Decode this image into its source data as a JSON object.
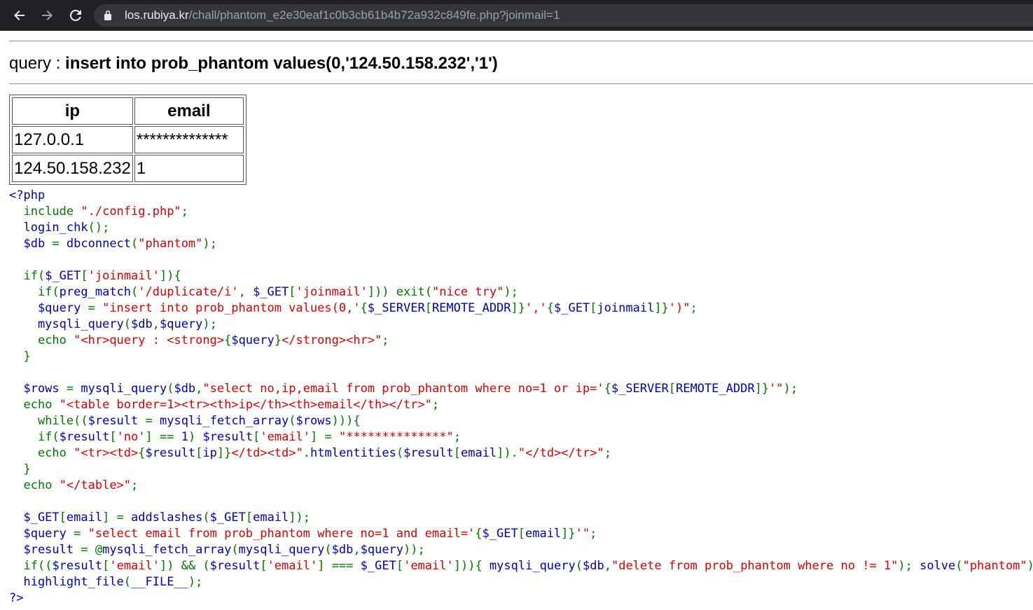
{
  "browser": {
    "back_icon": "arrow-left-icon",
    "forward_icon": "arrow-right-icon",
    "reload_icon": "reload-icon",
    "lock_icon": "lock-icon",
    "url_host": "los.rubiya.kr",
    "url_path": "/chall/phantom_e2e30eaf1c0b3cb61b4b72a932c849fe.php?joinmail=1"
  },
  "page": {
    "query_label": "query : ",
    "query_text": "insert into prob_phantom values(0,'124.50.158.232','1')",
    "table": {
      "headers": [
        "ip",
        "email"
      ],
      "rows": [
        [
          "127.0.0.1",
          "**************"
        ],
        [
          "124.50.158.232",
          "1"
        ]
      ]
    },
    "code_lines": [
      [
        [
          "df",
          "<?php"
        ]
      ],
      [
        [
          "df",
          "  "
        ],
        [
          "kw",
          "include "
        ],
        [
          "st",
          "\"./config.php\""
        ],
        [
          "kw",
          ";"
        ]
      ],
      [
        [
          "df",
          "  login_chk"
        ],
        [
          "kw",
          "();"
        ]
      ],
      [
        [
          "df",
          "  $db "
        ],
        [
          "kw",
          "= "
        ],
        [
          "df",
          "dbconnect"
        ],
        [
          "kw",
          "("
        ],
        [
          "st",
          "\"phantom\""
        ],
        [
          "kw",
          ");"
        ]
      ],
      [
        [
          "df",
          " "
        ]
      ],
      [
        [
          "df",
          "  "
        ],
        [
          "kw",
          "if("
        ],
        [
          "df",
          "$_GET"
        ],
        [
          "kw",
          "["
        ],
        [
          "st",
          "'joinmail'"
        ],
        [
          "kw",
          "]){"
        ]
      ],
      [
        [
          "df",
          "    "
        ],
        [
          "kw",
          "if("
        ],
        [
          "df",
          "preg_match"
        ],
        [
          "kw",
          "("
        ],
        [
          "st",
          "'/duplicate/i'"
        ],
        [
          "kw",
          ", "
        ],
        [
          "df",
          "$_GET"
        ],
        [
          "kw",
          "["
        ],
        [
          "st",
          "'joinmail'"
        ],
        [
          "kw",
          "])) exit("
        ],
        [
          "st",
          "\"nice try\""
        ],
        [
          "kw",
          ");"
        ]
      ],
      [
        [
          "df",
          "    $query "
        ],
        [
          "kw",
          "= "
        ],
        [
          "st",
          "\"insert into prob_phantom values(0,'"
        ],
        [
          "kw",
          "{"
        ],
        [
          "df",
          "$_SERVER"
        ],
        [
          "kw",
          "["
        ],
        [
          "df",
          "REMOTE_ADDR"
        ],
        [
          "kw",
          "]}"
        ],
        [
          "st",
          "','"
        ],
        [
          "kw",
          "{"
        ],
        [
          "df",
          "$_GET"
        ],
        [
          "kw",
          "["
        ],
        [
          "df",
          "joinmail"
        ],
        [
          "kw",
          "]}"
        ],
        [
          "st",
          "')\""
        ],
        [
          "kw",
          ";"
        ]
      ],
      [
        [
          "df",
          "    mysqli_query"
        ],
        [
          "kw",
          "("
        ],
        [
          "df",
          "$db"
        ],
        [
          "kw",
          ","
        ],
        [
          "df",
          "$query"
        ],
        [
          "kw",
          ");"
        ]
      ],
      [
        [
          "df",
          "    "
        ],
        [
          "kw",
          "echo "
        ],
        [
          "st",
          "\"<hr>query : <strong>"
        ],
        [
          "kw",
          "{"
        ],
        [
          "df",
          "$query"
        ],
        [
          "kw",
          "}"
        ],
        [
          "st",
          "</strong><hr>\""
        ],
        [
          "kw",
          ";"
        ]
      ],
      [
        [
          "df",
          "  "
        ],
        [
          "kw",
          "}"
        ]
      ],
      [
        [
          "df",
          " "
        ]
      ],
      [
        [
          "df",
          "  $rows "
        ],
        [
          "kw",
          "= "
        ],
        [
          "df",
          "mysqli_query"
        ],
        [
          "kw",
          "("
        ],
        [
          "df",
          "$db"
        ],
        [
          "kw",
          ","
        ],
        [
          "st",
          "\"select no,ip,email from prob_phantom where no=1 or ip='"
        ],
        [
          "kw",
          "{"
        ],
        [
          "df",
          "$_SERVER"
        ],
        [
          "kw",
          "["
        ],
        [
          "df",
          "REMOTE_ADDR"
        ],
        [
          "kw",
          "]}"
        ],
        [
          "st",
          "'\""
        ],
        [
          "kw",
          ");"
        ]
      ],
      [
        [
          "df",
          "  "
        ],
        [
          "kw",
          "echo "
        ],
        [
          "st",
          "\"<table border=1><tr><th>ip</th><th>email</th></tr>\""
        ],
        [
          "kw",
          ";"
        ]
      ],
      [
        [
          "df",
          "    "
        ],
        [
          "kw",
          "while(("
        ],
        [
          "df",
          "$result "
        ],
        [
          "kw",
          "= "
        ],
        [
          "df",
          "mysqli_fetch_array"
        ],
        [
          "kw",
          "("
        ],
        [
          "df",
          "$rows"
        ],
        [
          "kw",
          "))){"
        ]
      ],
      [
        [
          "df",
          "    "
        ],
        [
          "kw",
          "if("
        ],
        [
          "df",
          "$result"
        ],
        [
          "kw",
          "["
        ],
        [
          "st",
          "'no'"
        ],
        [
          "kw",
          "] == "
        ],
        [
          "df",
          "1"
        ],
        [
          "kw",
          ") "
        ],
        [
          "df",
          "$result"
        ],
        [
          "kw",
          "["
        ],
        [
          "st",
          "'email'"
        ],
        [
          "kw",
          "] = "
        ],
        [
          "st",
          "\"**************\""
        ],
        [
          "kw",
          ";"
        ]
      ],
      [
        [
          "df",
          "    "
        ],
        [
          "kw",
          "echo "
        ],
        [
          "st",
          "\"<tr><td>"
        ],
        [
          "kw",
          "{"
        ],
        [
          "df",
          "$result"
        ],
        [
          "kw",
          "["
        ],
        [
          "df",
          "ip"
        ],
        [
          "kw",
          "]}"
        ],
        [
          "st",
          "</td><td>\""
        ],
        [
          "kw",
          "."
        ],
        [
          "df",
          "htmlentities"
        ],
        [
          "kw",
          "("
        ],
        [
          "df",
          "$result"
        ],
        [
          "kw",
          "["
        ],
        [
          "df",
          "email"
        ],
        [
          "kw",
          "])."
        ],
        [
          "st",
          "\"</td></tr>\""
        ],
        [
          "kw",
          ";"
        ]
      ],
      [
        [
          "df",
          "  "
        ],
        [
          "kw",
          "}"
        ]
      ],
      [
        [
          "df",
          "  "
        ],
        [
          "kw",
          "echo "
        ],
        [
          "st",
          "\"</table>\""
        ],
        [
          "kw",
          ";"
        ]
      ],
      [
        [
          "df",
          " "
        ]
      ],
      [
        [
          "df",
          "  $_GET"
        ],
        [
          "kw",
          "["
        ],
        [
          "df",
          "email"
        ],
        [
          "kw",
          "] = "
        ],
        [
          "df",
          "addslashes"
        ],
        [
          "kw",
          "("
        ],
        [
          "df",
          "$_GET"
        ],
        [
          "kw",
          "["
        ],
        [
          "df",
          "email"
        ],
        [
          "kw",
          "]);"
        ]
      ],
      [
        [
          "df",
          "  $query "
        ],
        [
          "kw",
          "= "
        ],
        [
          "st",
          "\"select email from prob_phantom where no=1 and email='"
        ],
        [
          "kw",
          "{"
        ],
        [
          "df",
          "$_GET"
        ],
        [
          "kw",
          "["
        ],
        [
          "df",
          "email"
        ],
        [
          "kw",
          "]}"
        ],
        [
          "st",
          "'\""
        ],
        [
          "kw",
          ";"
        ]
      ],
      [
        [
          "df",
          "  $result "
        ],
        [
          "kw",
          "= @"
        ],
        [
          "df",
          "mysqli_fetch_array"
        ],
        [
          "kw",
          "("
        ],
        [
          "df",
          "mysqli_query"
        ],
        [
          "kw",
          "("
        ],
        [
          "df",
          "$db"
        ],
        [
          "kw",
          ","
        ],
        [
          "df",
          "$query"
        ],
        [
          "kw",
          "));"
        ]
      ],
      [
        [
          "df",
          "  "
        ],
        [
          "kw",
          "if(("
        ],
        [
          "df",
          "$result"
        ],
        [
          "kw",
          "["
        ],
        [
          "st",
          "'email'"
        ],
        [
          "kw",
          "]) && ("
        ],
        [
          "df",
          "$result"
        ],
        [
          "kw",
          "["
        ],
        [
          "st",
          "'email'"
        ],
        [
          "kw",
          "] === "
        ],
        [
          "df",
          "$_GET"
        ],
        [
          "kw",
          "["
        ],
        [
          "st",
          "'email'"
        ],
        [
          "kw",
          "])){ "
        ],
        [
          "df",
          "mysqli_query"
        ],
        [
          "kw",
          "("
        ],
        [
          "df",
          "$db"
        ],
        [
          "kw",
          ","
        ],
        [
          "st",
          "\"delete from prob_phantom where no != 1\""
        ],
        [
          "kw",
          "); "
        ],
        [
          "df",
          "solve"
        ],
        [
          "kw",
          "("
        ],
        [
          "st",
          "\"phantom\""
        ],
        [
          "kw",
          "); }"
        ]
      ],
      [
        [
          "df",
          "  highlight_file"
        ],
        [
          "kw",
          "("
        ],
        [
          "df",
          "__FILE__"
        ],
        [
          "kw",
          ");"
        ]
      ],
      [
        [
          "df",
          "?>"
        ]
      ]
    ]
  }
}
